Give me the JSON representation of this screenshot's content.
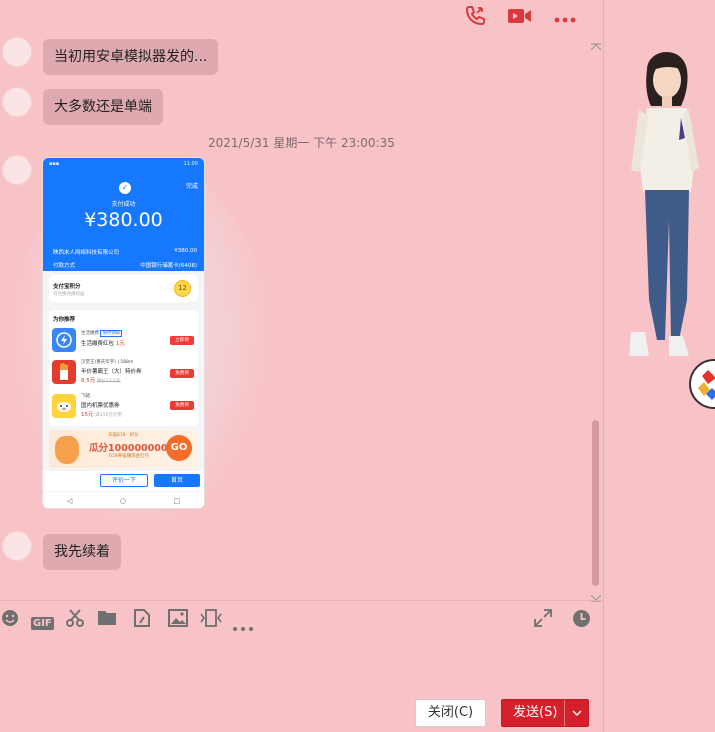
{
  "header": {
    "icons": [
      "voice-call-icon",
      "video-call-icon",
      "more-icon"
    ]
  },
  "messages": [
    {
      "text": "当初用安卓模拟器发的..."
    },
    {
      "text": "大多数还是单端"
    }
  ],
  "timestamp": "2021/5/31 星期一 下午 23:00:35",
  "screenshot": {
    "status_time": "11:00",
    "done": "完成",
    "success": "支付成功",
    "amount": "¥380.00",
    "merchant": "陕西未人网络科技有限公司",
    "merchant_amount": "¥380.00",
    "pay_method_label": "付款方式",
    "pay_method": "中国银行储蓄卡(6408)",
    "points_title": "支付宝积分",
    "points_sub": "可兑换兑换权益",
    "points_value": "12",
    "rec_title": "为你推荐",
    "recs": [
      {
        "brand": "生活缴费",
        "tag": "限时领取",
        "title": "生活缴费红包",
        "price": "1元",
        "old": "",
        "btn": "立即领",
        "color": "#3a86f5"
      },
      {
        "brand": "汉堡王(重庆华宇)",
        "tag": "588m",
        "title": "半价薯霸王（大）特价券",
        "price": "6.5元",
        "old": "原价13.5元",
        "btn": "免费领",
        "color": "#e43c2c"
      },
      {
        "brand": "飞猪",
        "tag": "",
        "title": "国内机票优惠券",
        "price": "15元",
        "old": "满150元可用",
        "btn": "免费领",
        "color": "#ffd43a"
      }
    ],
    "promo_top": "天猫618 · 好价",
    "promo_main": "瓜分1000000000元",
    "promo_sub": "618养猫赚现金红包",
    "promo_go": "GO",
    "eval_btn": "评价一下",
    "home_btn": "首页"
  },
  "last_message": "我先续着",
  "toolbar": {
    "icons": [
      "emoji-icon",
      "gif-icon",
      "screenshot-scissors-icon",
      "folder-icon",
      "send-file-icon",
      "image-icon",
      "screen-record-icon",
      "more-icon",
      "expand-icon",
      "history-clock-icon"
    ],
    "gif_label": "GIF"
  },
  "buttons": {
    "close": "关闭(C)",
    "send": "发送(S)"
  }
}
